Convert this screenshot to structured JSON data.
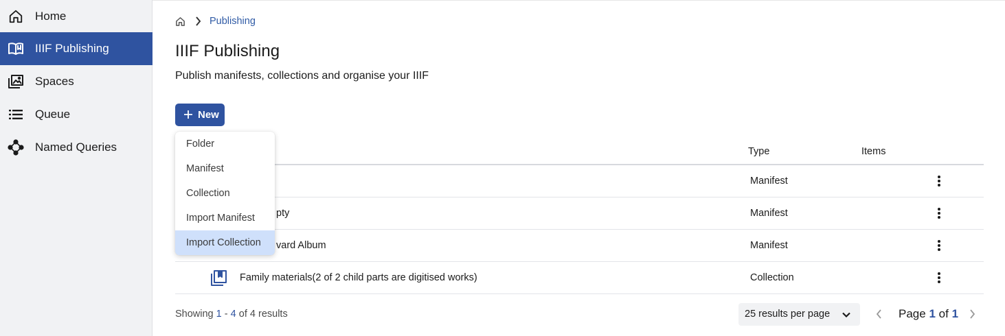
{
  "sidebar": {
    "items": [
      {
        "label": "Home",
        "icon": "home-icon",
        "active": false
      },
      {
        "label": "IIIF Publishing",
        "icon": "open-book-icon",
        "active": true
      },
      {
        "label": "Spaces",
        "icon": "image-stack-icon",
        "active": false
      },
      {
        "label": "Queue",
        "icon": "list-icon",
        "active": false
      },
      {
        "label": "Named Queries",
        "icon": "network-nodes-icon",
        "active": false
      }
    ]
  },
  "breadcrumb": {
    "home_icon": "home-icon",
    "separator_icon": "chevron-right-icon",
    "current": "Publishing"
  },
  "page": {
    "title": "IIIF Publishing",
    "description": "Publish manifests, collections and organise your IIIF"
  },
  "new_button": {
    "label": "New",
    "icon": "plus-icon"
  },
  "new_menu": {
    "items": [
      {
        "label": "Folder",
        "highlighted": false
      },
      {
        "label": "Manifest",
        "highlighted": false
      },
      {
        "label": "Collection",
        "highlighted": false
      },
      {
        "label": "Import Manifest",
        "highlighted": false
      },
      {
        "label": "Import Collection",
        "highlighted": true
      }
    ]
  },
  "table": {
    "columns": {
      "type": "Type",
      "items": "Items"
    },
    "rows": [
      {
        "title_visible": "",
        "type": "Manifest",
        "items": ""
      },
      {
        "title_visible": "pty",
        "type": "Manifest",
        "items": ""
      },
      {
        "title_visible": "vard Album",
        "type": "Manifest",
        "items": ""
      },
      {
        "title_visible": "Family materials(2 of 2 child parts are digitised works)",
        "type": "Collection",
        "items": "",
        "icon": "collection-icon"
      }
    ]
  },
  "footer": {
    "showing_prefix": "Showing",
    "range_start": "1",
    "range_sep": "-",
    "range_end": "4",
    "of_word": "of",
    "total": "4",
    "results_word": "results",
    "per_page_label": "25 results per page",
    "page_word": "Page",
    "page_current": "1",
    "page_of": "of",
    "page_total": "1"
  },
  "colors": {
    "accent": "#2f53a0",
    "sidebar_bg": "#f1f2f4",
    "menu_highlight": "#cfe0fb",
    "link": "#2f5aa5"
  }
}
